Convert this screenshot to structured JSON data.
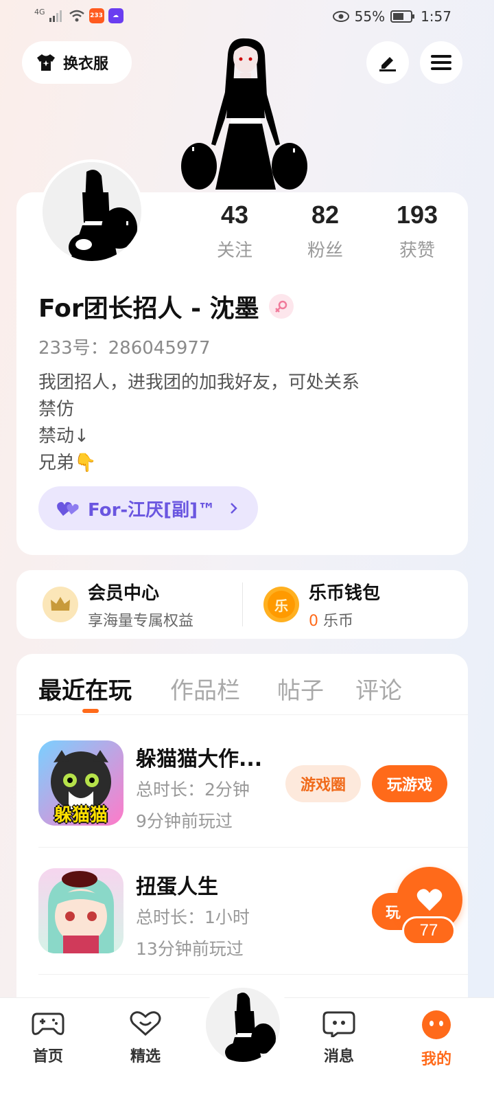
{
  "status_bar": {
    "network": "4G",
    "app_badge": "233",
    "battery": "55%",
    "time": "1:57"
  },
  "top": {
    "outfit_label": "换衣服",
    "edit_icon": "pen-icon",
    "menu_icon": "hamburger-icon"
  },
  "profile": {
    "stats": [
      {
        "num": "43",
        "label": "关注"
      },
      {
        "num": "82",
        "label": "粉丝"
      },
      {
        "num": "193",
        "label": "获赞"
      }
    ],
    "username": "For团长招人 - 沈墨",
    "gender": "female",
    "uid": "233号：286045977",
    "bio": [
      "我团招人，进我团的加我好友，可处关系",
      "禁仿",
      "禁动↓",
      "兄弟👇"
    ],
    "group": "For-江厌[副]™"
  },
  "member": {
    "title": "会员中心",
    "sub": "享海量专属权益"
  },
  "wallet": {
    "title": "乐币钱包",
    "amount": "0",
    "unit": "乐币",
    "icon_char": "乐"
  },
  "tabs": [
    "最近在玩",
    "作品栏",
    "帖子",
    "评论"
  ],
  "games": [
    {
      "title": "躲猫猫大作...",
      "duration": "总时长：2分钟",
      "last_played": "9分钟前玩过",
      "icon_text": "躲猫猫",
      "circle_btn": "游戏圈",
      "play_btn": "玩游戏"
    },
    {
      "title": "扭蛋人生",
      "duration": "总时长：1小时",
      "last_played": "13分钟前玩过",
      "play_btn_partial": "玩"
    }
  ],
  "like": {
    "count": "77"
  },
  "nav": {
    "home": "首页",
    "featured": "精选",
    "messages": "消息",
    "mine": "我的"
  },
  "colors": {
    "accent": "#ff6a1a",
    "group_purple": "#6a56e0",
    "group_bg": "#ebe7fd"
  }
}
